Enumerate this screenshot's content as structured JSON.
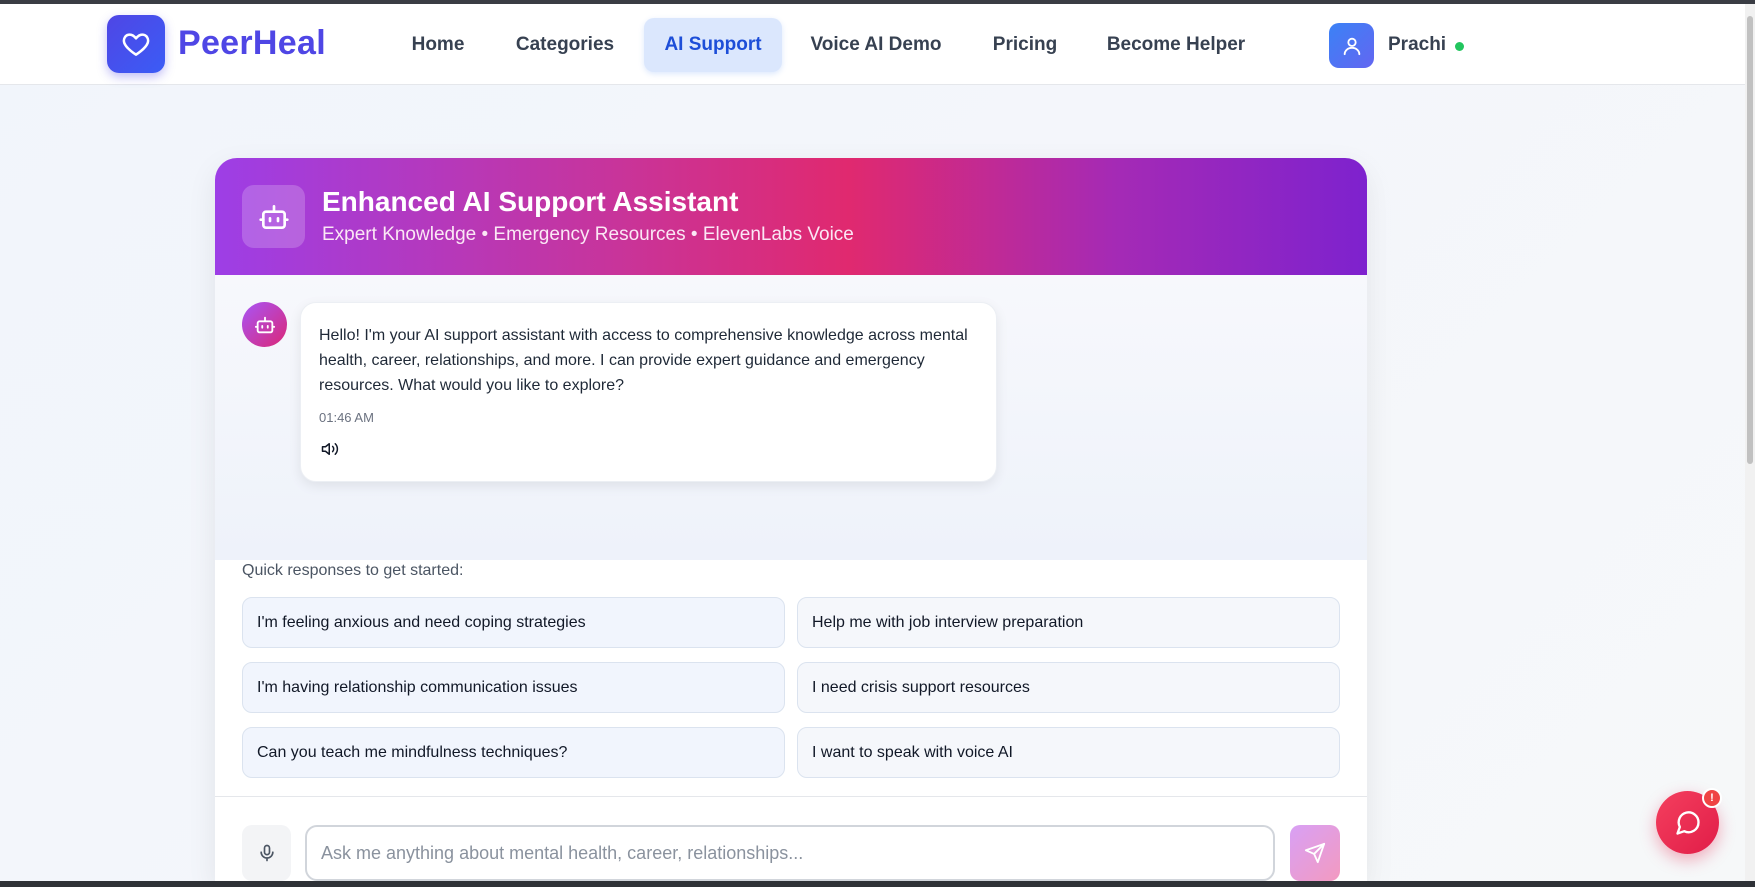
{
  "nav": {
    "brand": "PeerHeal",
    "items": [
      {
        "label": "Home"
      },
      {
        "label": "Categories"
      },
      {
        "label": "AI Support"
      },
      {
        "label": "Voice AI Demo"
      },
      {
        "label": "Pricing"
      },
      {
        "label": "Become Helper"
      }
    ],
    "active": "AI Support",
    "user": {
      "name": "Prachi",
      "status": "online"
    }
  },
  "assistant": {
    "title": "Enhanced AI Support Assistant",
    "subtitle": "Expert Knowledge • Emergency Resources • ElevenLabs Voice"
  },
  "messages": [
    {
      "sender": "bot",
      "text": "Hello! I'm your AI support assistant with access to comprehensive knowledge across mental health, career, relationships, and more. I can provide expert guidance and emergency resources. What would you like to explore?",
      "time": "01:46 AM"
    }
  ],
  "quick": {
    "label": "Quick responses to get started:",
    "options": [
      "I'm feeling anxious and need coping strategies",
      "Help me with job interview preparation",
      "I'm having relationship communication issues",
      "I need crisis support resources",
      "Can you teach me mindfulness techniques?",
      "I want to speak with voice AI"
    ]
  },
  "input": {
    "placeholder": "Ask me anything about mental health, career, relationships...",
    "value": ""
  },
  "fab": {
    "badge": "!"
  },
  "colors": {
    "brand": "#4f46e5",
    "active_nav_bg": "#dbe7fd",
    "header_gradient": [
      "#9d3ee6",
      "#e0296f",
      "#7e22ce"
    ],
    "online": "#22c55e",
    "fab": "#e11d48"
  },
  "icons": {
    "logo": "heart-icon",
    "user": "user-icon",
    "assistant": "robot-icon",
    "speaker": "speaker-icon",
    "mic": "mic-icon",
    "send": "send-icon",
    "fab": "chat-bubble-icon"
  }
}
